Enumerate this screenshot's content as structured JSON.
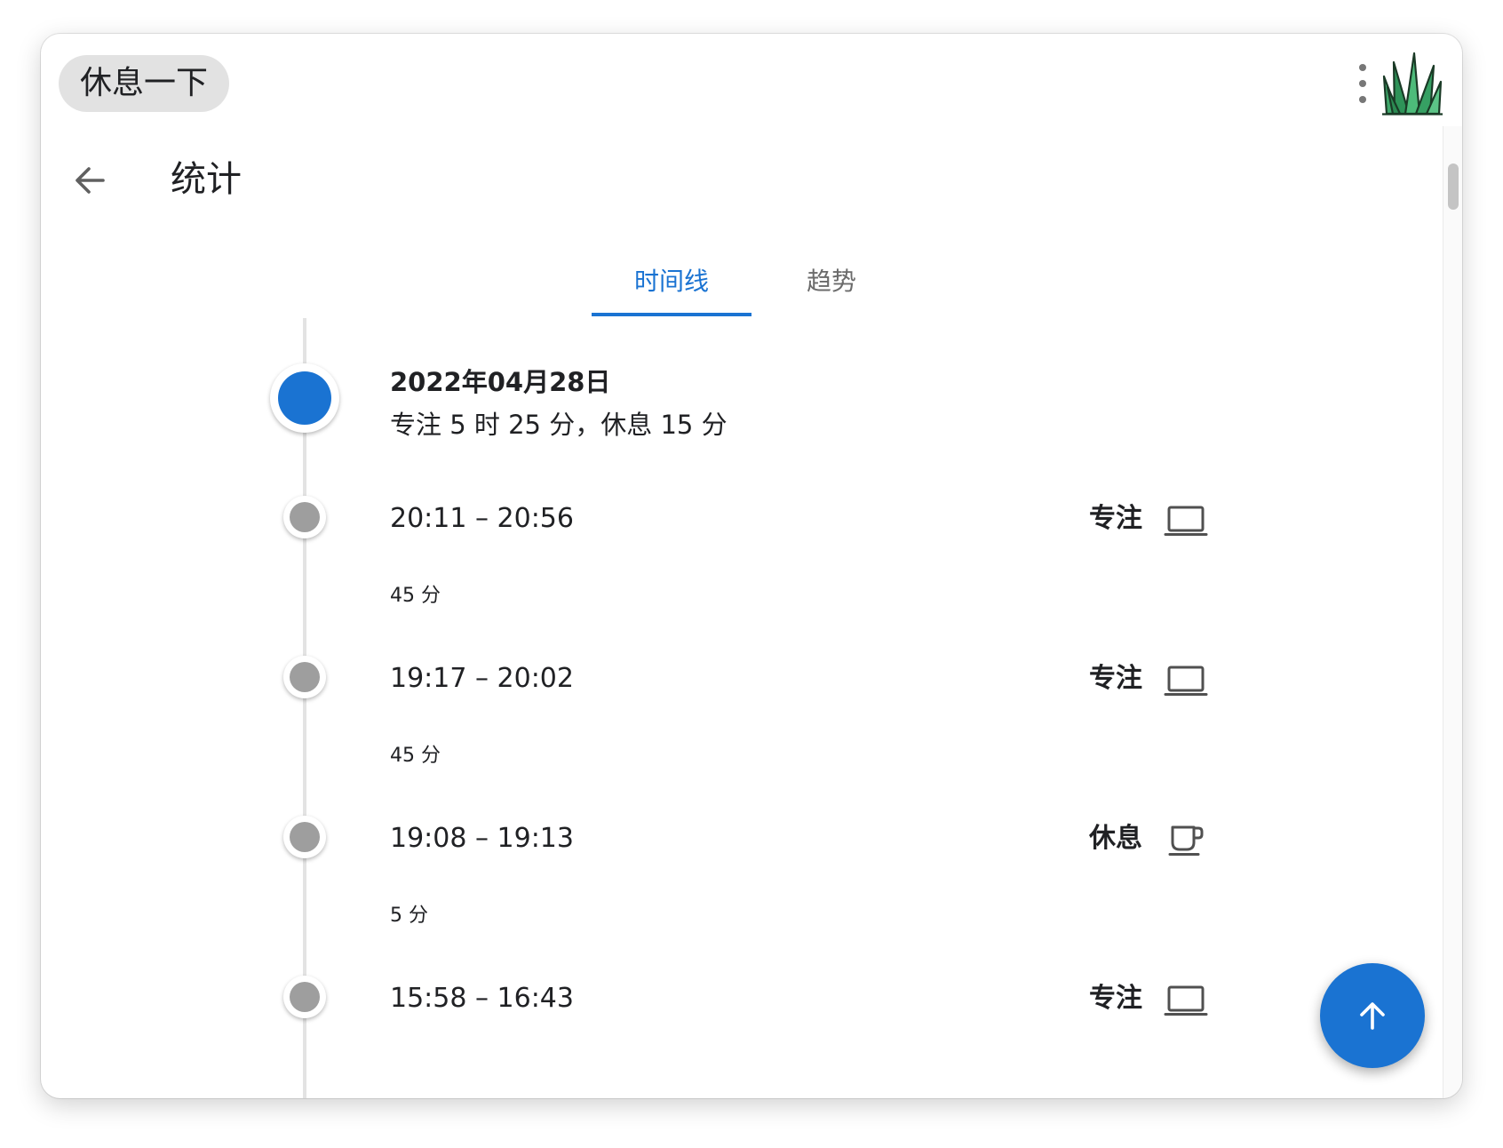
{
  "app": {
    "chip_label": "休息一下",
    "icons": {
      "menu": "more-vert-icon",
      "logo": "grass-logo",
      "back": "arrow-back-icon",
      "fab": "arrow-up-icon"
    }
  },
  "page": {
    "title": "统计"
  },
  "tabs": [
    {
      "label": "时间线",
      "active": true
    },
    {
      "label": "趋势",
      "active": false
    }
  ],
  "timeline": {
    "day": {
      "date": "2022年04月28日",
      "summary": "专注 5 时 25 分，休息 15 分"
    },
    "entries": [
      {
        "time_range": "20:11 – 20:56",
        "duration": "45 分",
        "kind": "专注",
        "icon": "laptop-icon"
      },
      {
        "time_range": "19:17 – 20:02",
        "duration": "45 分",
        "kind": "专注",
        "icon": "laptop-icon"
      },
      {
        "time_range": "19:08 – 19:13",
        "duration": "5 分",
        "kind": "休息",
        "icon": "coffee-cup-icon"
      },
      {
        "time_range": "15:58 – 16:43",
        "duration": "",
        "kind": "专注",
        "icon": "laptop-icon"
      }
    ]
  },
  "colors": {
    "accent": "#1a73d2",
    "node_gray": "#9e9e9e",
    "chip_bg": "#e2e2e2",
    "line": "#e3e3e3"
  }
}
